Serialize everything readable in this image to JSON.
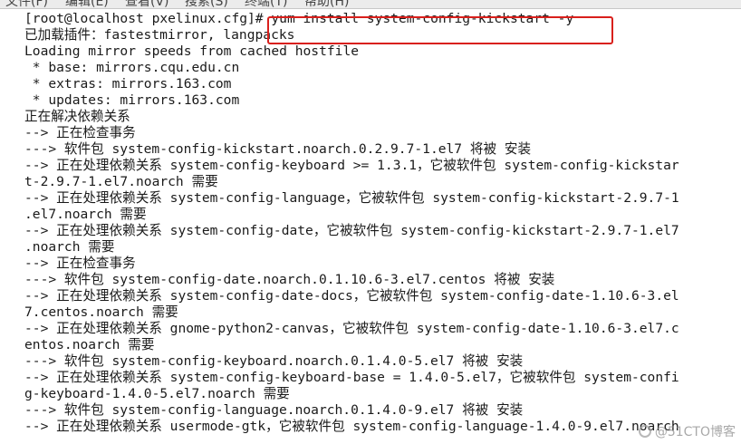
{
  "menubar": {
    "items": [
      "文件(F)",
      "编辑(E)",
      "查看(V)",
      "搜索(S)",
      "终端(T)",
      "帮助(H)"
    ]
  },
  "terminal": {
    "lines": [
      "[root@localhost pxelinux.cfg]# yum install system-config-kickstart -y",
      "已加载插件：fastestmirror, langpacks",
      "Loading mirror speeds from cached hostfile",
      " * base: mirrors.cqu.edu.cn",
      " * extras: mirrors.163.com",
      " * updates: mirrors.163.com",
      "正在解决依赖关系",
      "--> 正在检查事务",
      "---> 软件包 system-config-kickstart.noarch.0.2.9.7-1.el7 将被 安装",
      "--> 正在处理依赖关系 system-config-keyboard >= 1.3.1，它被软件包 system-config-kickstar",
      "t-2.9.7-1.el7.noarch 需要",
      "--> 正在处理依赖关系 system-config-language，它被软件包 system-config-kickstart-2.9.7-1",
      ".el7.noarch 需要",
      "--> 正在处理依赖关系 system-config-date，它被软件包 system-config-kickstart-2.9.7-1.el7",
      ".noarch 需要",
      "--> 正在检查事务",
      "---> 软件包 system-config-date.noarch.0.1.10.6-3.el7.centos 将被 安装",
      "--> 正在处理依赖关系 system-config-date-docs，它被软件包 system-config-date-1.10.6-3.el",
      "7.centos.noarch 需要",
      "--> 正在处理依赖关系 gnome-python2-canvas，它被软件包 system-config-date-1.10.6-3.el7.c",
      "entos.noarch 需要",
      "---> 软件包 system-config-keyboard.noarch.0.1.4.0-5.el7 将被 安装",
      "--> 正在处理依赖关系 system-config-keyboard-base = 1.4.0-5.el7，它被软件包 system-confi",
      "g-keyboard-1.4.0-5.el7.noarch 需要",
      "---> 软件包 system-config-language.noarch.0.1.4.0-9.el7 将被 安装",
      "--> 正在处理依赖关系 usermode-gtk，它被软件包 system-config-language-1.4.0-9.el7.noarch"
    ]
  },
  "watermark": {
    "text": "@51CTO博客"
  }
}
